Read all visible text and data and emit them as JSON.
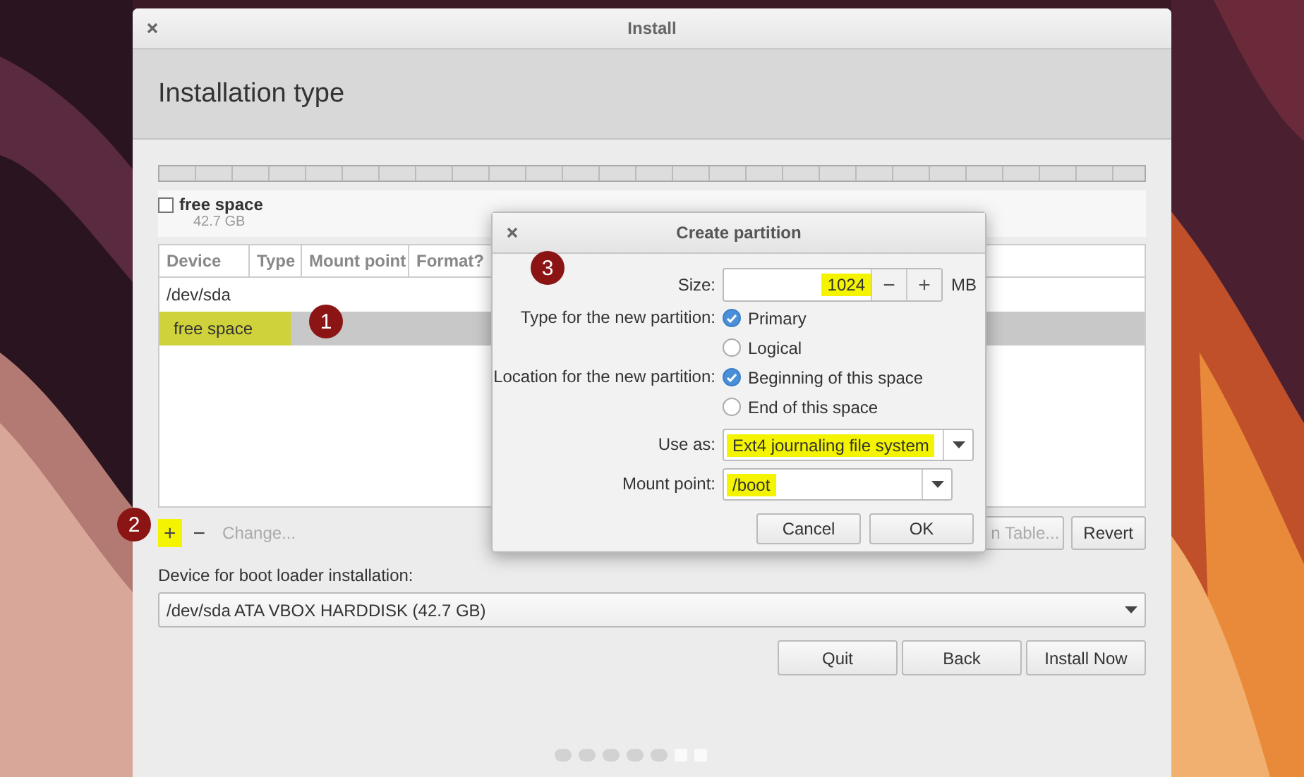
{
  "window": {
    "title": "Install",
    "heading": "Installation type"
  },
  "partition_legend": {
    "label": "free space",
    "size": "42.7 GB"
  },
  "table": {
    "columns": [
      "Device",
      "Type",
      "Mount point",
      "Format?"
    ],
    "rows": [
      {
        "cells": [
          "/dev/sda"
        ],
        "selected": false,
        "highlighted": false
      },
      {
        "cells": [
          "free space"
        ],
        "selected": true,
        "highlighted": true
      }
    ]
  },
  "toolbar": {
    "add": {
      "label": "+",
      "highlighted": true
    },
    "remove": {
      "label": "−"
    },
    "change": {
      "label": "Change...",
      "disabled": true
    },
    "right_buttons": [
      {
        "label": "n Table...",
        "disabled": true
      },
      {
        "label": "Revert",
        "disabled": false
      }
    ]
  },
  "bootloader": {
    "label": "Device for boot loader installation:",
    "value": "/dev/sda ATA VBOX HARDDISK (42.7 GB)"
  },
  "buttons": [
    "Quit",
    "Back",
    "Install Now"
  ],
  "steps": [
    {
      "done": true
    },
    {
      "done": true
    },
    {
      "done": true
    },
    {
      "done": true
    },
    {
      "done": true
    },
    {
      "done": false
    },
    {
      "done": false
    }
  ],
  "dialog": {
    "title": "Create partition",
    "size": {
      "label": "Size:",
      "value": "1024",
      "highlighted": true,
      "minus": "−",
      "plus": "+",
      "unit": "MB"
    },
    "type": {
      "label": "Type for the new partition:",
      "options": [
        {
          "label": "Primary",
          "selected": true
        },
        {
          "label": "Logical",
          "selected": false
        }
      ]
    },
    "location": {
      "label": "Location for the new partition:",
      "options": [
        {
          "label": "Beginning of this space",
          "selected": true
        },
        {
          "label": "End of this space",
          "selected": false
        }
      ]
    },
    "use_as": {
      "label": "Use as:",
      "value": "Ext4 journaling file system",
      "highlighted": true
    },
    "mount_point": {
      "label": "Mount point:",
      "value": "/boot",
      "highlighted": true
    },
    "buttons": [
      "Cancel",
      "OK"
    ]
  },
  "annotations": [
    {
      "text": "1"
    },
    {
      "text": "2"
    },
    {
      "text": "3"
    }
  ]
}
